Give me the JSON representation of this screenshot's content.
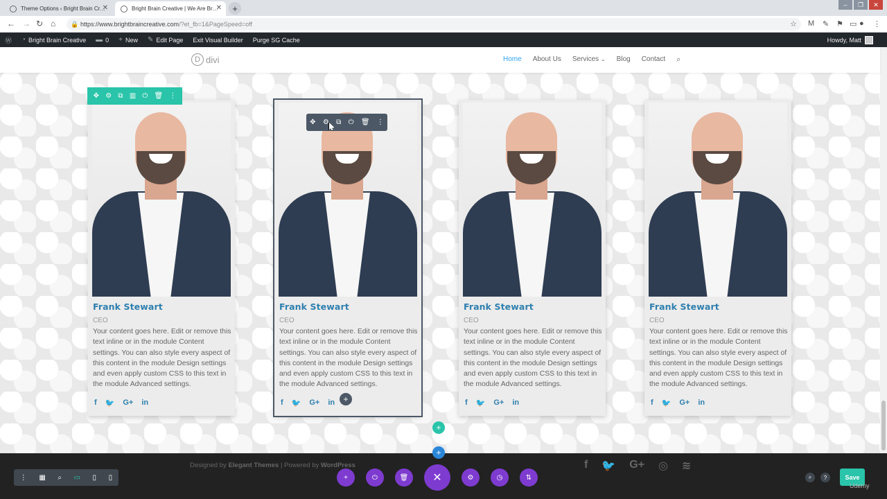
{
  "browser": {
    "tabs": [
      {
        "title": "Theme Options ‹ Bright Brain Cr…",
        "active": false
      },
      {
        "title": "Bright Brain Creative | We Are Br…",
        "active": true
      }
    ],
    "url_main": "https://www.brightbraincreative.com",
    "url_query": "/?et_fb=1&PageSpeed=off"
  },
  "adminbar": {
    "site": "Bright Brain Creative",
    "comments": "0",
    "new": "New",
    "edit": "Edit Page",
    "exit": "Exit Visual Builder",
    "purge": "Purge SG Cache",
    "howdy": "Howdy, Matt"
  },
  "header": {
    "logo_letter": "D",
    "logo_text": "divi",
    "nav": [
      "Home",
      "About Us",
      "Services",
      "Blog",
      "Contact"
    ]
  },
  "cards": [
    {
      "name": "Frank Stewart",
      "position": "CEO",
      "desc": "Your content goes here. Edit or remove this text inline or in the module Content settings. You can also style every aspect of this content in the module Design settings and even apply custom CSS to this text in the module Advanced settings."
    },
    {
      "name": "Frank Stewart",
      "position": "CEO",
      "desc": "Your content goes here. Edit or remove this text inline or in the module Content settings. You can also style every aspect of this content in the module Design settings and even apply custom CSS to this text in the module Advanced settings."
    },
    {
      "name": "Frank Stewart",
      "position": "CEO",
      "desc": "Your content goes here. Edit or remove this text inline or in the module Content settings. You can also style every aspect of this content in the module Design settings and even apply custom CSS to this text in the module Advanced settings."
    },
    {
      "name": "Frank Stewart",
      "position": "CEO",
      "desc": "Your content goes here. Edit or remove this text inline or in the module Content settings. You can also style every aspect of this content in the module Design settings and even apply custom CSS to this text in the module Advanced settings."
    }
  ],
  "social_glyphs": {
    "facebook": "f",
    "twitter": "🐦",
    "google": "G+",
    "linkedin": "in"
  },
  "footer": {
    "designed_by": "Designed by",
    "elegant": "Elegant Themes",
    "powered_by": "| Powered by",
    "wordpress": "WordPress"
  },
  "builder": {
    "save": "Save",
    "watermark": "Udemy"
  },
  "colors": {
    "accent": "#2ea3f2",
    "row_green": "#29c4a9",
    "module_dark": "#4c5866",
    "page_purple": "#7e3bd0",
    "section_blue": "#2b87da",
    "name_blue": "#2e7fae"
  }
}
